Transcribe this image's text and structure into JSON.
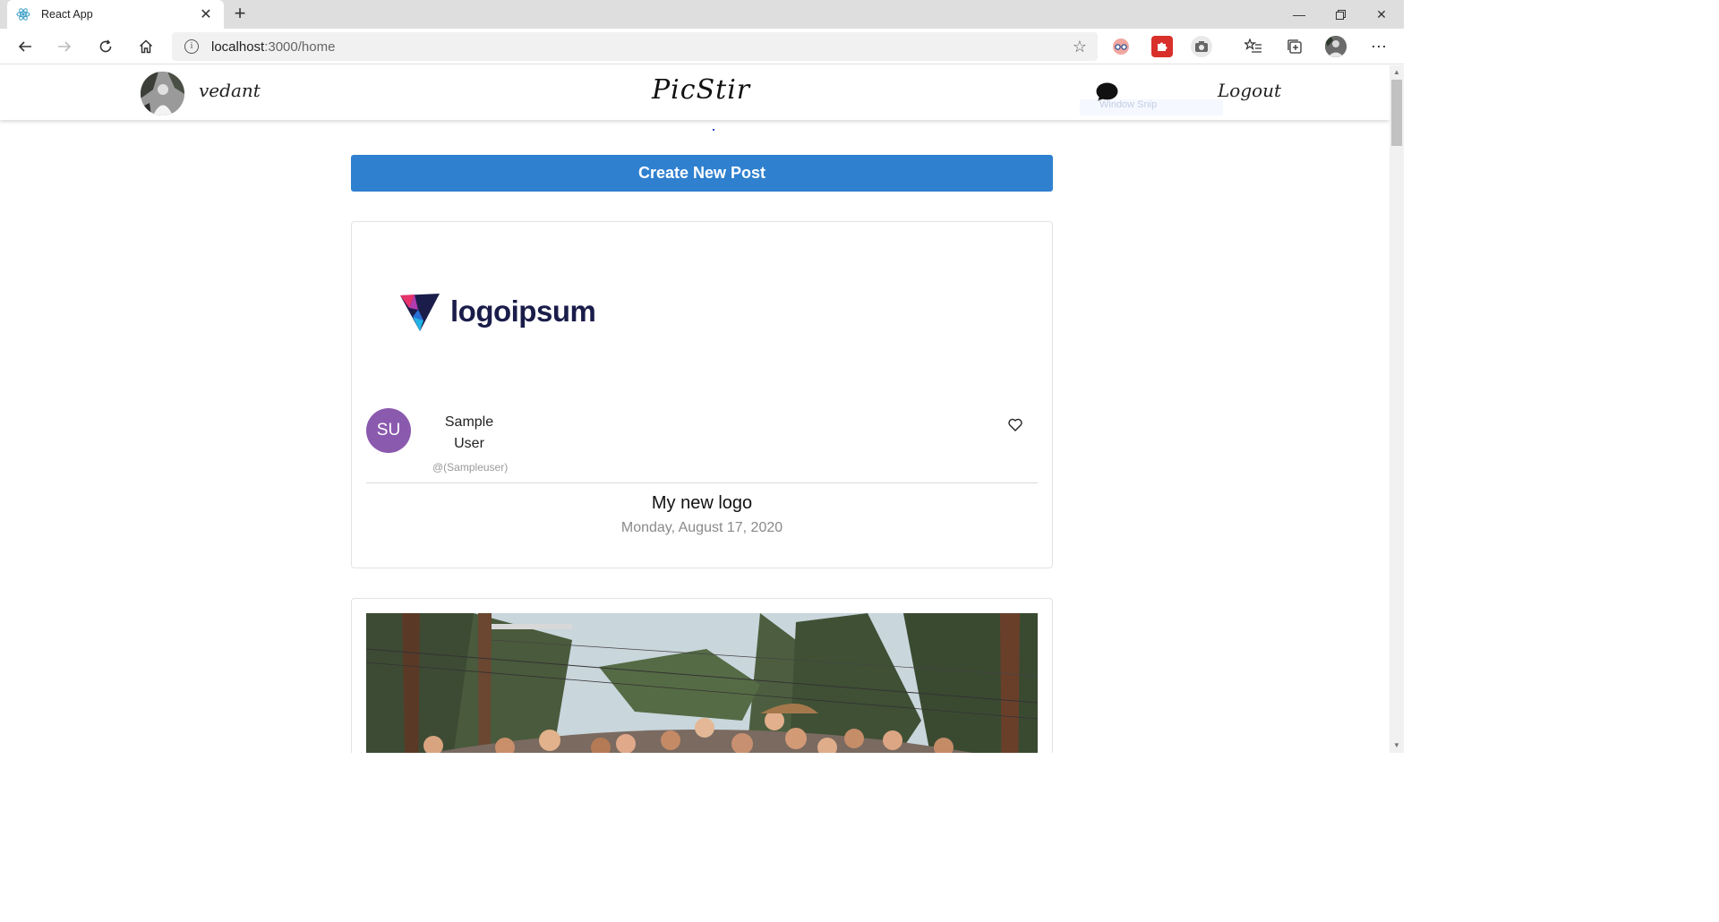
{
  "browser": {
    "tab_title": "React App",
    "url_host": "localhost",
    "url_path": ":3000/home"
  },
  "navbar": {
    "username": "vedant",
    "brand": "PicStir",
    "logout_label": "Logout",
    "faint_overlay_text": "Window Snip"
  },
  "create_post_label": "Create New Post",
  "posts": [
    {
      "logo_text": "logoipsum",
      "avatar_initials": "SU",
      "author_name_line1": "Sample",
      "author_name_line2": "User",
      "author_handle": "@(Sampleuser)",
      "title": "My new logo",
      "date": "Monday, August 17, 2020"
    }
  ],
  "colors": {
    "primary_button": "#2f80cf",
    "avatar_bg": "#8a5aae",
    "logo_text": "#1a1d4a"
  }
}
